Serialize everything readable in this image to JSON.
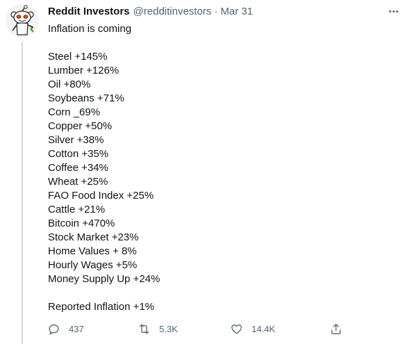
{
  "tweet": {
    "author_name": "Reddit Investors",
    "handle": "@redditinvestors",
    "separator": "·",
    "date": "Mar 31",
    "lines": [
      "Inflation is coming",
      "",
      "Steel +145%",
      "Lumber +126%",
      "Oil +80%",
      "Soybeans +71%",
      "Corn _69%",
      "Copper +50%",
      "Silver +38%",
      "Cotton +35%",
      "Coffee +34%",
      "Wheat +25%",
      "FAO Food Index +25%",
      "Cattle +21%",
      "Bitcoin +470%",
      "Stock Market +23%",
      "Home Values + 8%",
      "Hourly Wages +5%",
      "Money Supply Up +24%",
      "",
      "Reported Inflation +1%"
    ]
  },
  "actions": {
    "reply_count": "437",
    "retweet_count": "5.3K",
    "like_count": "14.4K"
  },
  "icons": {
    "avatar": "reddit-alien-avatar",
    "more": "more-options-icon",
    "reply": "reply-icon",
    "retweet": "retweet-icon",
    "like": "heart-icon",
    "share": "share-icon"
  },
  "colors": {
    "text_primary": "#0f1419",
    "text_secondary": "#536471",
    "thread_line": "#cfd9de",
    "avatar_accent": "#ff4500"
  }
}
